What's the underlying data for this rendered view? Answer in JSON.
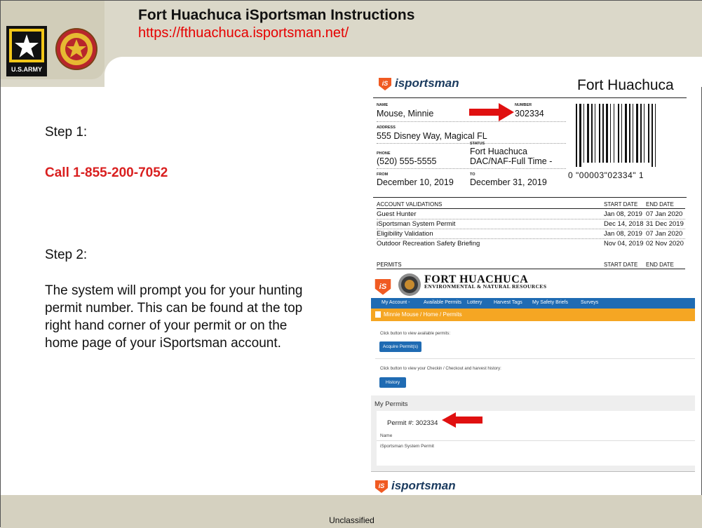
{
  "header": {
    "title": "Fort Huachuca iSportsman Instructions",
    "url": "https://fthuachuca.isportsman.net/",
    "army_logo_text": "U.S.ARMY"
  },
  "steps": {
    "step1_label": "Step 1:",
    "call_text": "Call 1-855-200-7052",
    "step2_label": "Step 2:",
    "step2_text": "The system will prompt you for your hunting permit number. This can be found at the top right hand corner of your permit or on the home page of your iSportsman account."
  },
  "permit_card": {
    "brand": "isportsman",
    "location": "Fort Huachuca",
    "name_label": "NAME",
    "name": "Mouse, Minnie",
    "number_label": "NUMBER",
    "number": "302334",
    "address_label": "ADDRESS",
    "address": "555 Disney Way, Magical  FL",
    "phone_label": "PHONE",
    "phone": "(520) 555-5555",
    "status_label": "STATUS",
    "status_line1": "Fort Huachuca",
    "status_line2": "DAC/NAF-Full Time -",
    "from_label": "FROM",
    "from": "December 10, 2019",
    "to_label": "TO",
    "to": "December 31, 2019",
    "barcode_number": "0 \"00003\"02334\" 1",
    "validations_header": "ACCOUNT VALIDATIONS",
    "start_header": "START DATE",
    "end_header": "END DATE",
    "validations": [
      {
        "name": "Guest Hunter",
        "start": "Jan 08, 2019",
        "end": "07 Jan 2020"
      },
      {
        "name": "iSportsman System Permit",
        "start": "Dec 14, 2018",
        "end": "31 Dec 2019"
      },
      {
        "name": "Eligibility Validation",
        "start": "Jan 08, 2019",
        "end": "07 Jan 2020"
      },
      {
        "name": "Outdoor Recreation Safety Briefing",
        "start": "Nov 04, 2019",
        "end": "02 Nov 2020"
      }
    ],
    "permits_header": "PERMITS",
    "permits_start_header": "START DATE",
    "permits_end_header": "END DATE"
  },
  "web": {
    "org_title": "FORT HUACHUCA",
    "org_subtitle": "ENVIRONMENTAL & NATURAL RESOURCES",
    "nav": [
      "My Account -",
      "Available Permits",
      "Lottery",
      "Harvest Tags",
      "My Safety Briefs",
      "Surveys"
    ],
    "breadcrumb": "Minnie Mouse  /  Home  /  Permits",
    "acquire_prompt": "Click button to view available permits:",
    "acquire_button": "Acquire Permit(s)",
    "history_prompt": "Click button to view your Checkin / Checkout and harvest history:",
    "history_button": "History",
    "my_permits": "My Permits",
    "permit_number": "Permit #: 302334",
    "name_col": "Name",
    "permit_name": "iSportsman System Permit",
    "footer_brand": "isportsman"
  },
  "footer": {
    "classification": "Unclassified"
  },
  "colors": {
    "accent_red": "#e60000",
    "nav_blue": "#1f6bb3",
    "breadcrumb_orange": "#f5a623",
    "isportsman_orange": "#f05a22"
  }
}
